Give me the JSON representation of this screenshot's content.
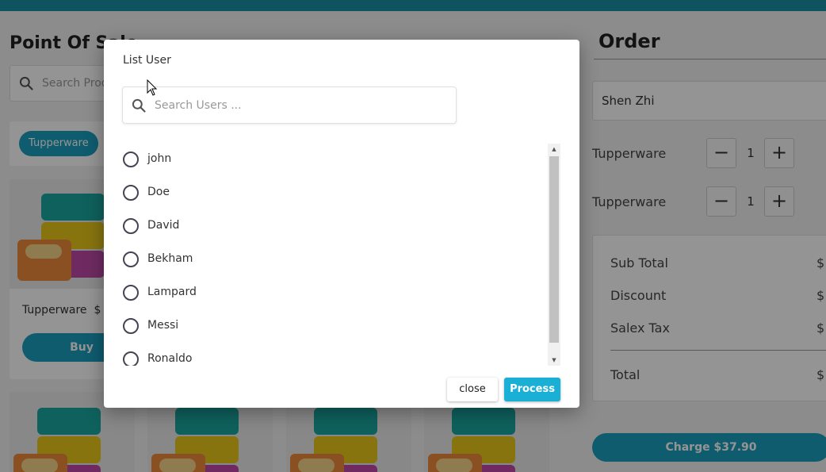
{
  "pos": {
    "title": "Point Of Sale",
    "search_placeholder": "Search Products ...",
    "category_chip": "Tupperware",
    "product": {
      "name": "Tupperware",
      "price": "$",
      "buy_label": "Buy"
    }
  },
  "order": {
    "title": "Order",
    "customer": "Shen Zhi",
    "lines": [
      {
        "name": "Tupperware",
        "qty": "1",
        "minus": "−",
        "plus": "+"
      },
      {
        "name": "Tupperware",
        "qty": "1",
        "minus": "−",
        "plus": "+"
      }
    ],
    "summary": {
      "sub_total_label": "Sub Total",
      "sub_total_value": "$",
      "discount_label": "Discount",
      "discount_value": "$",
      "tax_label": "Salex Tax",
      "tax_value": "$",
      "total_label": "Total",
      "total_value": "$"
    },
    "charge_label": "Charge $37.90"
  },
  "modal": {
    "title": "List User",
    "search_placeholder": "Search Users ...",
    "users": [
      "john",
      "Doe",
      "David",
      "Bekham",
      "Lampard",
      "Messi",
      "Ronaldo"
    ],
    "close_label": "close",
    "process_label": "Process"
  },
  "colors": {
    "accent": "#1a9fc0",
    "topbar": "#1a8fa8",
    "process": "#1ab0d6"
  },
  "icons": [
    "search-icon",
    "radio-icon",
    "cursor-icon"
  ]
}
